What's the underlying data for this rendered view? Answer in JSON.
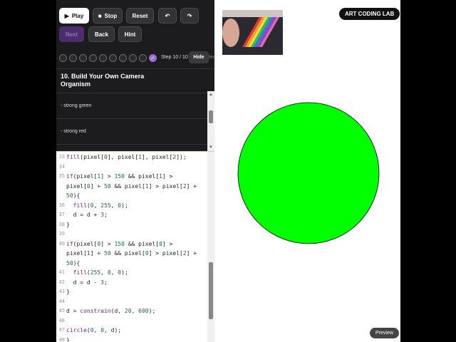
{
  "toolbar": {
    "play_label": "Play",
    "stop_label": "Stop",
    "reset_label": "Reset",
    "undo_icon": "undo-icon",
    "redo_icon": "redo-icon",
    "next_label": "Next",
    "back_label": "Back",
    "hint_label": "Hint"
  },
  "progress": {
    "total": 10,
    "completed": 10,
    "label": "Step 10 / 10",
    "hide_label": "Hide",
    "trailing": "tec"
  },
  "instructions": {
    "title": "10. Build Your Own Camera Organism",
    "lines": [
      "- strong green",
      "- strong red"
    ]
  },
  "code": {
    "lines": [
      {
        "n": "33",
        "text": "fill(pixel[0], pixel[1], pixel[2]);"
      },
      {
        "n": "34",
        "text": ""
      },
      {
        "n": "35",
        "text": "if(pixel[1] > 150 && pixel[1] >"
      },
      {
        "n": "",
        "text": "pixel[0] + 50 && pixel[1] > pixel[2] +"
      },
      {
        "n": "",
        "text": "50){"
      },
      {
        "n": "36",
        "text": "  fill(0, 255, 0);"
      },
      {
        "n": "37",
        "text": "  d = d + 3;"
      },
      {
        "n": "38",
        "text": "}"
      },
      {
        "n": "39",
        "text": ""
      },
      {
        "n": "40",
        "text": "if(pixel[0] > 150 && pixel[0] >"
      },
      {
        "n": "",
        "text": "pixel[1] + 50 && pixel[0] > pixel[2] +"
      },
      {
        "n": "",
        "text": "50){"
      },
      {
        "n": "41",
        "text": "  fill(255, 0, 0);"
      },
      {
        "n": "42",
        "text": "  d = d - 3;"
      },
      {
        "n": "43",
        "text": "}"
      },
      {
        "n": "44",
        "text": ""
      },
      {
        "n": "45",
        "text": "d = constrain(d, 20, 600);"
      },
      {
        "n": "46",
        "text": ""
      },
      {
        "n": "47",
        "text": "circle(0, 0, d);"
      },
      {
        "n": "48",
        "text": "}"
      }
    ]
  },
  "canvas": {
    "brand": "ART CODING LAB",
    "preview_label": "Preview",
    "circle_color": "#00ff00"
  },
  "colors": {
    "accent": "#9a6ad6",
    "panel_bg": "#1c1c1e"
  }
}
